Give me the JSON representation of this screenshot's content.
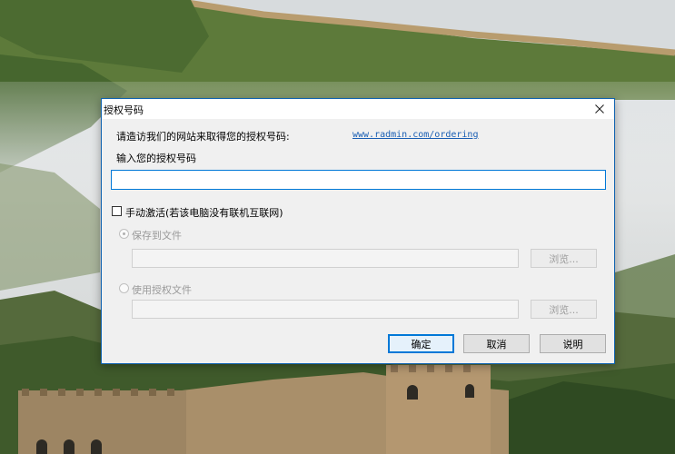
{
  "dialog": {
    "title": "授权号码",
    "visit_label": "请造访我们的网站来取得您的授权号码:",
    "website_link": "www.radmin.com/ordering",
    "input_label": "输入您的授权号码",
    "license_value": "",
    "manual_activation_label": "手动激活(若该电脑没有联机互联网)",
    "save_to_file_label": "保存到文件",
    "use_license_file_label": "使用授权文件",
    "browse_label_1": "浏览...",
    "browse_label_2": "浏览...",
    "ok_label": "确定",
    "cancel_label": "取消",
    "help_label": "说明"
  }
}
